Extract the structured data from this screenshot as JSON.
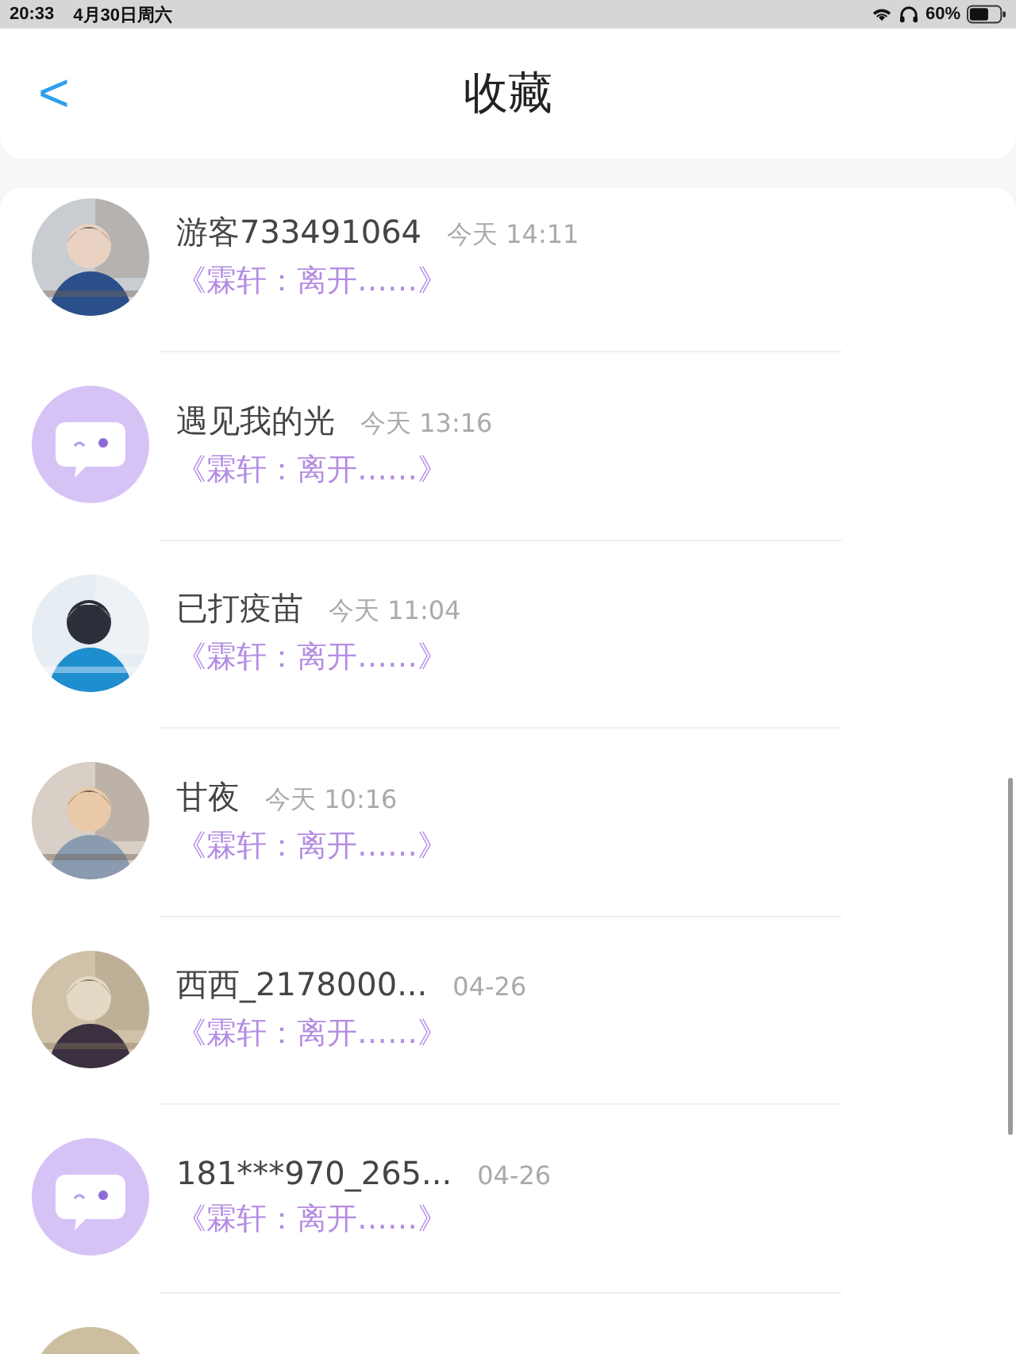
{
  "status_bar": {
    "time": "20:33",
    "date": "4月30日周六",
    "battery": "60%"
  },
  "header": {
    "back": "<",
    "title": "收藏"
  },
  "items": [
    {
      "name": "游客733491064",
      "time": "今天 14:11",
      "subtitle": "《霖轩：离开……》"
    },
    {
      "avatar": {
        "kind": "default"
      },
      "name": "遇见我的光",
      "time": "今天 13:16",
      "subtitle": "《霖轩：离开……》"
    },
    {
      "name": "已打疫苗",
      "time": "今天 11:04",
      "subtitle": "《霖轩：离开……》"
    },
    {
      "name": "甘夜",
      "time": "今天 10:16",
      "subtitle": "《霖轩：离开……》"
    },
    {
      "name": "西西_2178000...",
      "time": "04-26",
      "subtitle": "《霖轩：离开……》"
    },
    {
      "avatar": {
        "kind": "default"
      },
      "name": "181***970_265...",
      "time": "04-26",
      "subtitle": "《霖轩：离开……》"
    }
  ]
}
